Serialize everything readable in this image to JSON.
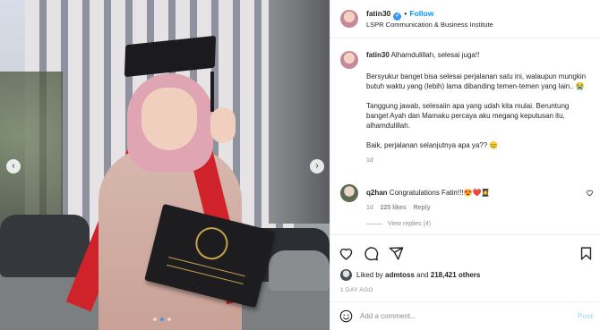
{
  "header": {
    "username": "fatin30",
    "verified_glyph": "✓",
    "separator": "•",
    "follow_label": "Follow",
    "location": "LSPR Communication & Business Institute"
  },
  "caption": {
    "username": "fatin30",
    "first_line": "Alhamdulillah, selesai juga!!",
    "paragraph_1": "Bersyukur banget bisa selesai perjalanan satu ini, walaupun mungkin butuh waktu yang (lebih) lama dibanding temen-temen yang lain.. 😭",
    "paragraph_2": "Tanggung jawab, selesaiin apa yang udah kita mulai. Beruntung banget Ayah dan Mamaku percaya aku megang keputusan itu, alhamdulillah.",
    "paragraph_3": "Baik, perjalanan selanjutnya apa ya?? 😊",
    "time": "1d"
  },
  "reply": {
    "username": "q2han",
    "text": "Congratulations Fatin!!!😍❤️👩‍🎓",
    "time": "1d",
    "likes": "225 likes",
    "reply_label": "Reply",
    "view_replies": "View replies (4)"
  },
  "actions": {
    "icons": [
      "heart-icon",
      "comment-icon",
      "share-icon",
      "bookmark-icon"
    ]
  },
  "likes": {
    "prefix": "Liked by",
    "user": "admtoss",
    "conjunction": "and",
    "count": "218,421 others"
  },
  "date": "1 DAY AGO",
  "add_comment": {
    "placeholder": "Add a comment...",
    "post_label": "Post"
  },
  "carousel": {
    "prev_glyph": "‹",
    "next_glyph": "›",
    "slides": 3,
    "active": 1
  },
  "colors": {
    "accent": "#0095f6",
    "verified": "#3897f0",
    "muted": "#8e8e8e"
  }
}
